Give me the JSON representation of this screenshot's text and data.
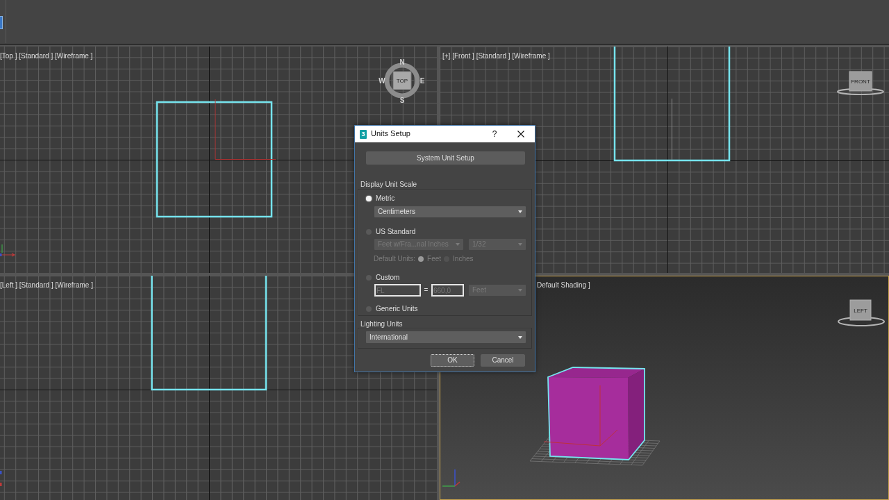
{
  "viewports": [
    {
      "kind": "top",
      "label": "[Top ] [Standard ] [Wireframe ]",
      "selected": false,
      "viewcube": {
        "face": "TOP",
        "compass": [
          "N",
          "E",
          "S",
          "W"
        ]
      }
    },
    {
      "kind": "front",
      "label": "[+] [Front ] [Standard ] [Wireframe ]",
      "selected": false,
      "viewcube": {
        "face": "FRONT"
      }
    },
    {
      "kind": "left",
      "label": "[Left ] [Standard ] [Wireframe ]",
      "selected": false
    },
    {
      "kind": "perspective",
      "label": "Default Shading ]",
      "selected": true,
      "viewcube": {
        "face": "LEFT"
      }
    }
  ],
  "dialog": {
    "app_icon": "3",
    "title": "Units Setup",
    "help": "?",
    "system_button": "System Unit Setup",
    "display_unit_scale": {
      "title": "Display Unit Scale",
      "options": [
        {
          "label": "Metric",
          "selected": true,
          "dropdowns": [
            {
              "value": "Centimeters",
              "disabled": false
            }
          ]
        },
        {
          "label": "US Standard",
          "selected": false,
          "dropdowns": [
            {
              "value": "Feet w/Fra...nal Inches",
              "disabled": true
            },
            {
              "value": "1/32",
              "disabled": true
            }
          ],
          "default_units": {
            "label": "Default Units:",
            "disabled": true,
            "choices": [
              {
                "label": "Feet",
                "selected": true
              },
              {
                "label": "Inches",
                "selected": false
              }
            ]
          }
        },
        {
          "label": "Custom",
          "selected": false,
          "fields": [
            {
              "value": "FL",
              "disabled": true
            },
            {
              "value": "660,0",
              "disabled": true
            }
          ],
          "equals": "=",
          "dropdowns": [
            {
              "value": "Feet",
              "disabled": true
            }
          ]
        },
        {
          "label": "Generic Units",
          "selected": false
        }
      ]
    },
    "lighting_units": {
      "title": "Lighting Units",
      "dropdown": {
        "value": "International",
        "disabled": false
      }
    },
    "buttons": [
      {
        "label": "OK",
        "focused": true
      },
      {
        "label": "Cancel",
        "focused": false
      }
    ]
  }
}
